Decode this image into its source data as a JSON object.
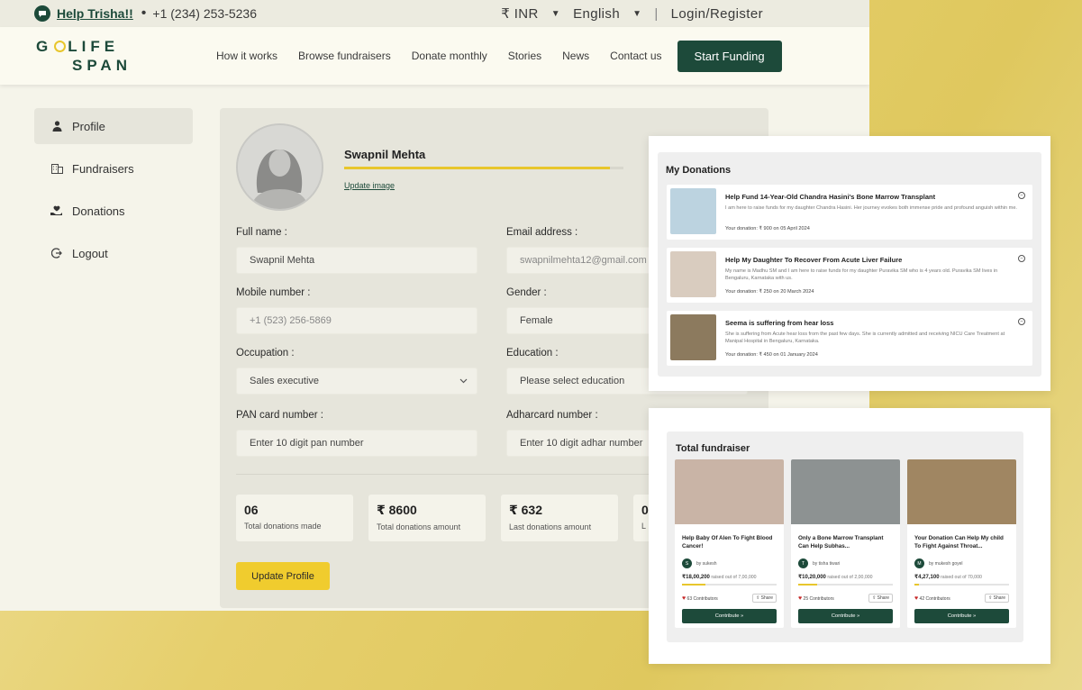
{
  "topbar": {
    "help_label": "Help Trisha!!",
    "phone": "+1 (234) 253-5236",
    "currency": "₹ INR",
    "language": "English",
    "login": "Login/Register"
  },
  "brand": {
    "line1_a": "G",
    "line1_b": "LIFE",
    "line2": "SPAN"
  },
  "nav": {
    "links": [
      "How it works",
      "Browse fundraisers",
      "Donate monthly",
      "Stories",
      "News",
      "Contact us"
    ],
    "cta": "Start Funding"
  },
  "sidebar": {
    "items": [
      {
        "label": "Profile",
        "icon": "user-icon"
      },
      {
        "label": "Fundraisers",
        "icon": "building-icon"
      },
      {
        "label": "Donations",
        "icon": "hand-heart-icon"
      },
      {
        "label": "Logout",
        "icon": "logout-icon"
      }
    ]
  },
  "profile": {
    "name": "Swapnil Mehta",
    "completion": 0.95,
    "update_image": "Update image",
    "fields": {
      "full_name_label": "Full name :",
      "full_name_value": "Swapnil Mehta",
      "email_label": "Email address :",
      "email_value": "swapnilmehta12@gmail.com",
      "mobile_label": "Mobile number :",
      "mobile_value": "+1 (523) 256-5869",
      "gender_label": "Gender :",
      "gender_value": "Female",
      "occupation_label": "Occupation :",
      "occupation_value": "Sales executive",
      "education_label": "Education :",
      "education_placeholder": "Please select education",
      "pan_label": "PAN card number :",
      "pan_placeholder": "Enter 10 digit pan number",
      "adhar_label": "Adharcard number :",
      "adhar_placeholder": "Enter 10 digit adhar number"
    },
    "stats": [
      {
        "value": "06",
        "label": "Total donations made"
      },
      {
        "value": "₹ 8600",
        "label": "Total donations amount"
      },
      {
        "value": "₹ 632",
        "label": "Last donations amount"
      },
      {
        "value": "0",
        "label": "L"
      }
    ],
    "update_button": "Update Profile"
  },
  "my_donations": {
    "title": "My Donations",
    "items": [
      {
        "title": "Help Fund 14-Year-Old Chandra Hasini's Bone Marrow Transplant",
        "desc": "I am here to raise funds for my daughter Chandra Hasini. Her journey evokes both immense pride and profound anguish within me.",
        "amount": "Your donation: ₹ 900 on 05 April 2024",
        "color": "#bcd3e0"
      },
      {
        "title": "Help My Daughter To Recover From Acute Liver Failure",
        "desc": "My name is Madhu SM and I am here to raise funds for my daughter Puravika SM who is 4 years old. Puravika SM lives in Bengaluru, Karnataka with us.",
        "amount": "Your donation: ₹ 250 on 20 March 2024",
        "color": "#d9ccbf"
      },
      {
        "title": "Seema is suffering from hear loss",
        "desc": "She is suffering from Acute hear loss from the past few days. She is currently admitted and receiving NICU Care Treatment at Manipal Hospital in Bengaluru, Karnataka.",
        "amount": "Your donation: ₹ 450 on 01 January 2024",
        "color": "#8c7a5e"
      }
    ]
  },
  "total_fundraiser": {
    "title": "Total fundraiser",
    "items": [
      {
        "title": "Help Baby Of Alen To Fight Blood Cancer!",
        "initial": "S",
        "by": "by sukesh",
        "raised": "₹18,00,200",
        "goal": "raised out of 7,00,000",
        "progress": 0.25,
        "contributors": "63 Contributors",
        "share": "Share",
        "button": "Contribute »",
        "color": "#c9b4a6"
      },
      {
        "title": "Only a Bone Marrow Transplant Can Help Subhas...",
        "initial": "T",
        "by": "by tisha tiwari",
        "raised": "₹10,20,000",
        "goal": "raised out of 2,00,000",
        "progress": 0.2,
        "contributors": "25 Contributors",
        "share": "Share",
        "button": "Contribute »",
        "color": "#8d9292"
      },
      {
        "title": "Your Donation Can Help My child To Fight Against Throat...",
        "initial": "M",
        "by": "by mukesh goyel",
        "raised": "₹4,27,100",
        "goal": "raised out of 70,000",
        "progress": 0.05,
        "contributors": "42 Contributors",
        "share": "Share",
        "button": "Contribute »",
        "color": "#a08662"
      }
    ]
  }
}
